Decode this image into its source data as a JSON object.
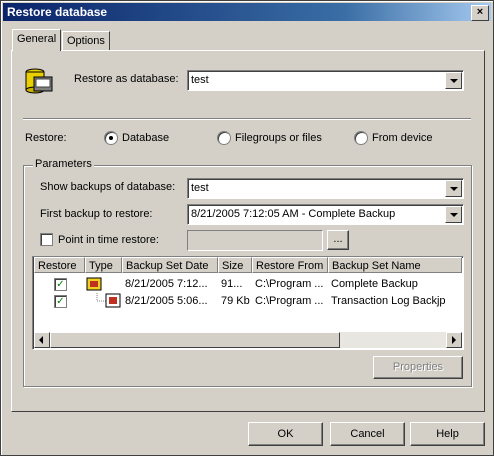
{
  "window": {
    "title": "Restore database",
    "close_glyph": "×"
  },
  "tabs": [
    {
      "label": "General"
    },
    {
      "label": "Options"
    }
  ],
  "restore_as": {
    "label": "Restore as database:",
    "value": "test"
  },
  "restore": {
    "label": "Restore:",
    "options": [
      {
        "label": "Database",
        "selected": true
      },
      {
        "label": "Filegroups or files",
        "selected": false
      },
      {
        "label": "From device",
        "selected": false
      }
    ]
  },
  "parameters": {
    "label": "Parameters",
    "show_backups_label": "Show backups of database:",
    "show_backups_value": "test",
    "first_backup_label": "First backup to restore:",
    "first_backup_value": "8/21/2005 7:12:05 AM - Complete Backup",
    "point_in_time_label": "Point in time restore:",
    "point_in_time_checked": false,
    "browse_label": "...",
    "properties_label": "Properties"
  },
  "backups_table": {
    "columns": [
      "Restore",
      "Type",
      "Backup Set Date",
      "Size",
      "Restore From",
      "Backup Set Name"
    ],
    "rows": [
      {
        "restore": "✓",
        "type_icon": "full-backup-icon",
        "date": "8/21/2005 7:12...",
        "size": "91...",
        "from": "C:\\Program ...",
        "name": "Complete Backup"
      },
      {
        "restore": "✓",
        "type_icon": "log-backup-icon",
        "date": "8/21/2005 5:06...",
        "size": "79 Kb",
        "from": "C:\\Program ...",
        "name": "Transaction Log Backjp"
      }
    ]
  },
  "buttons": {
    "ok": "OK",
    "cancel": "Cancel",
    "help": "Help"
  }
}
